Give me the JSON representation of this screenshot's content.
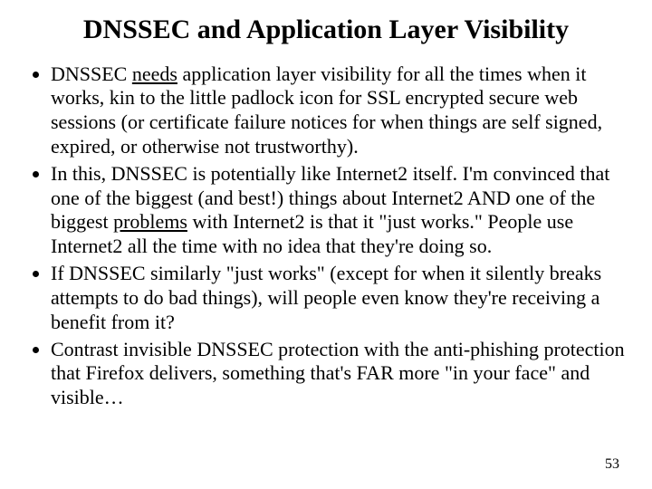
{
  "title": "DNSSEC and Application Layer Visibility",
  "bullets": [
    {
      "pre": "DNSSEC ",
      "u": "needs",
      "post": " application layer visibility for all the times when it works, kin to the little padlock icon for SSL encrypted secure web sessions (or certificate failure notices for when things are self signed, expired, or otherwise not trustworthy)."
    },
    {
      "pre": "In this, DNSSEC is potentially like Internet2 itself. I'm convinced that one of the biggest (and best!) things about Internet2 AND one of the biggest ",
      "u": "problems",
      "post": " with Internet2 is that it \"just works.\" People use Internet2 all the time with no idea that they're doing so."
    },
    {
      "pre": "If DNSSEC similarly \"just works\" (except for when it silently breaks attempts to do bad things), will people even know they're receiving a benefit from it?",
      "u": "",
      "post": ""
    },
    {
      "pre": "Contrast invisible DNSSEC protection with the anti-phishing protection that Firefox delivers, something that's FAR more \"in your face\" and visible…",
      "u": "",
      "post": ""
    }
  ],
  "page_number": "53"
}
